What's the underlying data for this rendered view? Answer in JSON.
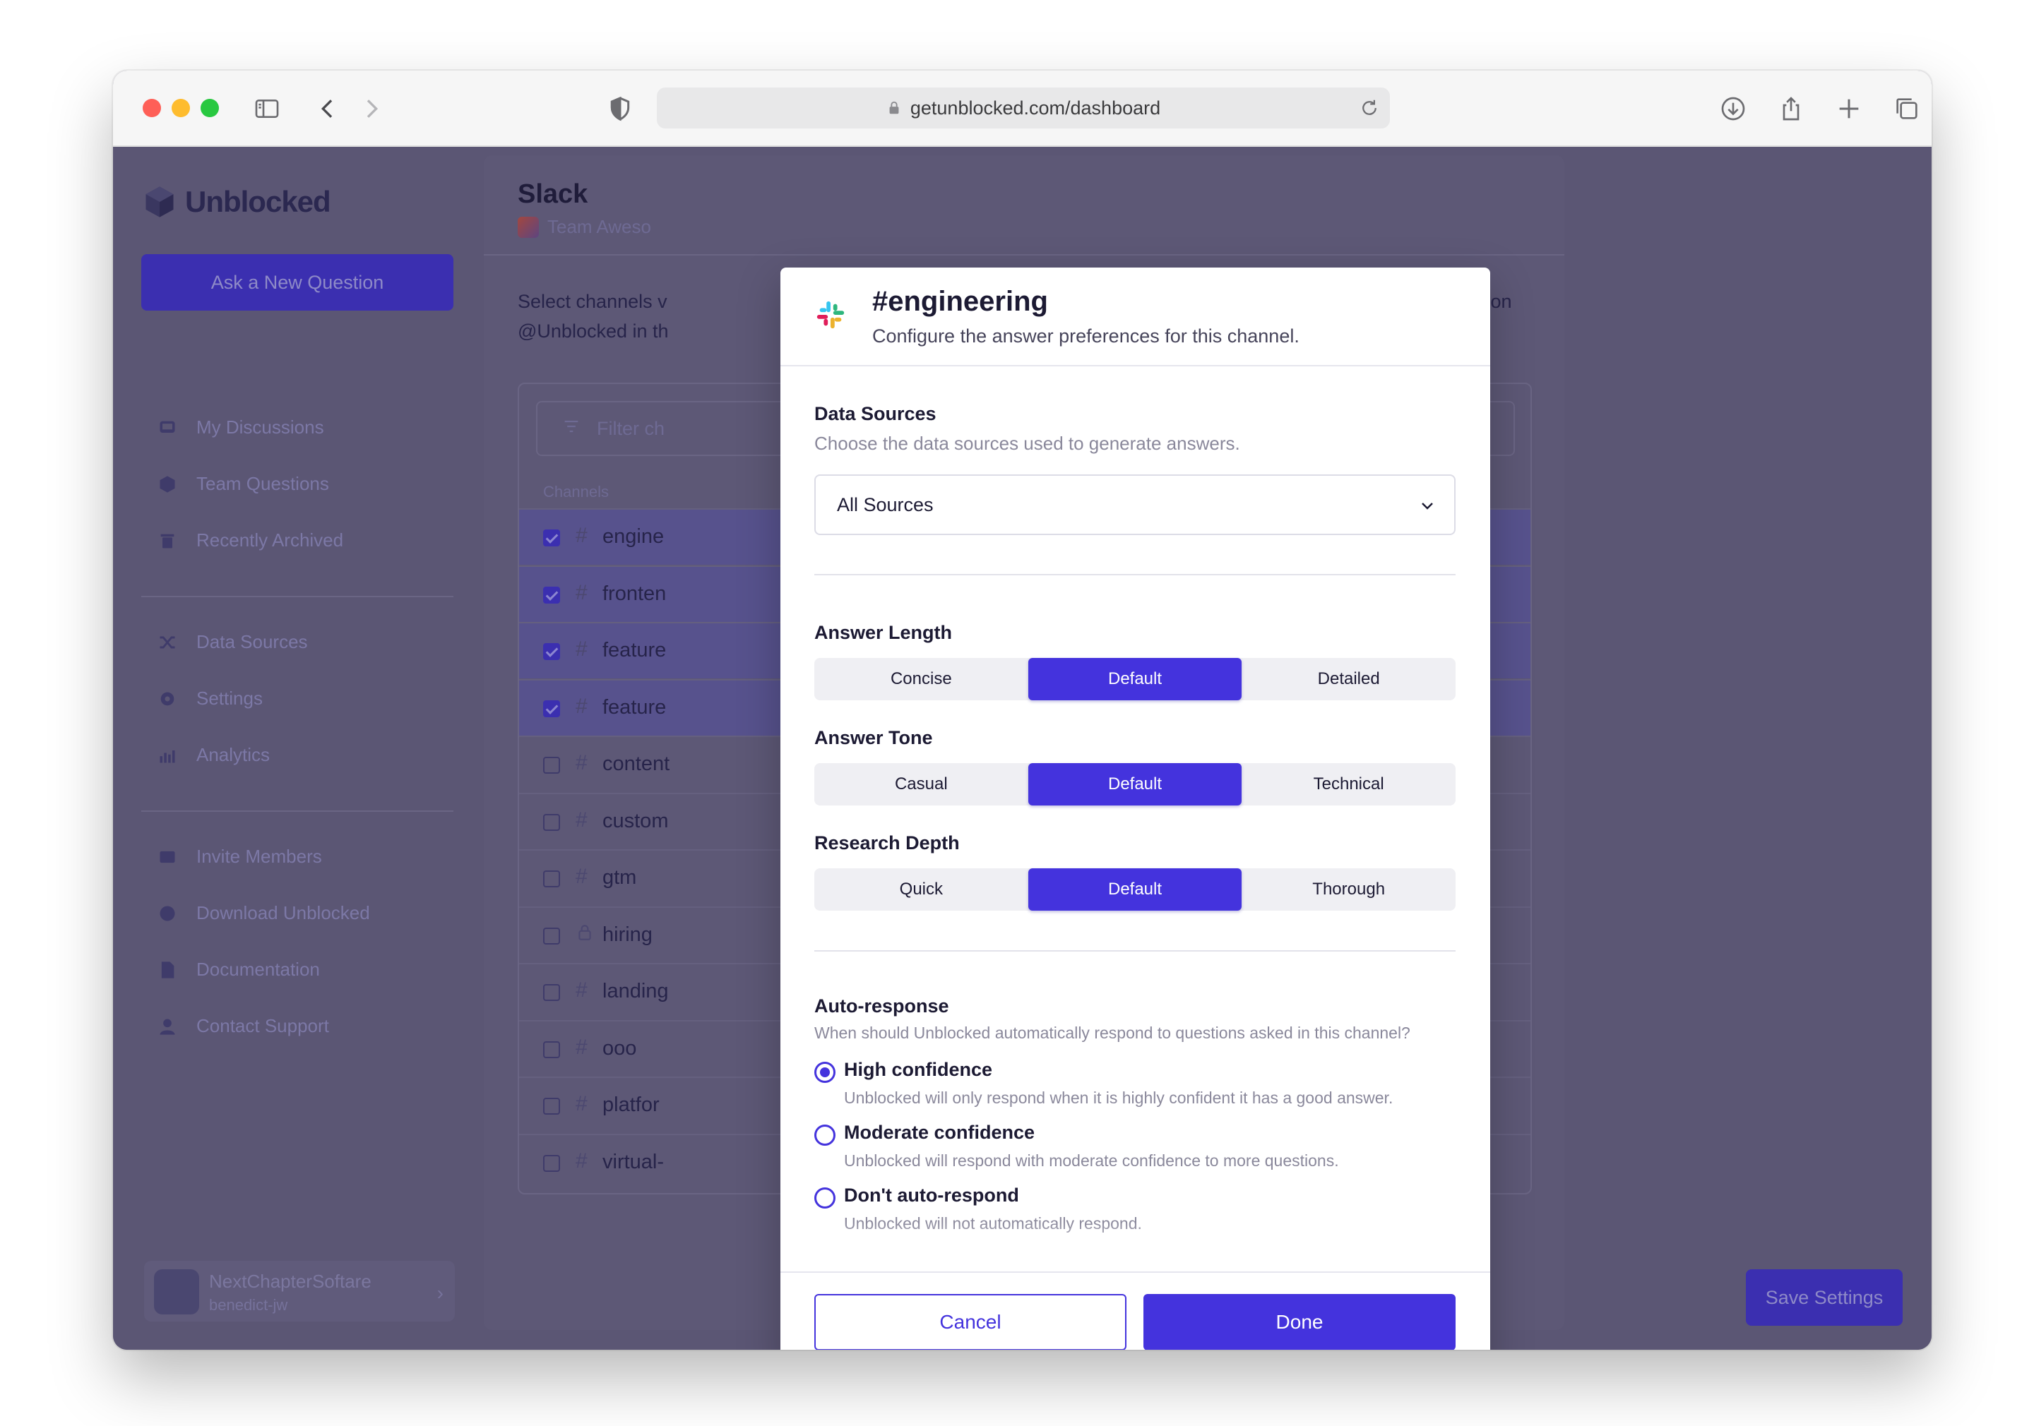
{
  "browser": {
    "url": "getunblocked.com/dashboard"
  },
  "sidebar": {
    "brand": "Unblocked",
    "ask_button": "Ask a New Question",
    "items": [
      {
        "label": "My Discussions",
        "icon": "chat-icon"
      },
      {
        "label": "Team Questions",
        "icon": "cube-icon"
      },
      {
        "label": "Recently Archived",
        "icon": "trash-icon"
      },
      {
        "label": "Data Sources",
        "icon": "shuffle-icon"
      },
      {
        "label": "Settings",
        "icon": "gear-icon"
      },
      {
        "label": "Analytics",
        "icon": "analytics-icon"
      },
      {
        "label": "Invite Members",
        "icon": "mail-icon"
      },
      {
        "label": "Download Unblocked",
        "icon": "download-icon"
      },
      {
        "label": "Documentation",
        "icon": "doc-icon"
      },
      {
        "label": "Contact Support",
        "icon": "person-icon"
      }
    ],
    "workspace": {
      "name": "NextChapterSoftare",
      "user": "benedict-jw"
    }
  },
  "main": {
    "title": "Slack",
    "team": "Team Aweso",
    "description_left_1": "Select channels v",
    "description_left_2": "@Unblocked in th",
    "description_right": "also @-mention",
    "filter_placeholder": "Filter ch",
    "column_header": "Channels",
    "channels": [
      {
        "name": "engine",
        "checked": true,
        "icon": "#"
      },
      {
        "name": "fronten",
        "checked": true,
        "icon": "#"
      },
      {
        "name": "feature",
        "checked": true,
        "icon": "#"
      },
      {
        "name": "feature",
        "checked": true,
        "icon": "#"
      },
      {
        "name": "content",
        "checked": false,
        "icon": "#"
      },
      {
        "name": "custom",
        "checked": false,
        "icon": "#"
      },
      {
        "name": "gtm",
        "checked": false,
        "icon": "#"
      },
      {
        "name": "hiring",
        "checked": false,
        "icon": "lock"
      },
      {
        "name": "landing",
        "checked": false,
        "icon": "#"
      },
      {
        "name": "ooo",
        "checked": false,
        "icon": "#"
      },
      {
        "name": "platfor",
        "checked": false,
        "icon": "#"
      },
      {
        "name": "virtual-",
        "checked": false,
        "icon": "#"
      }
    ],
    "save_button": "Save Settings"
  },
  "modal": {
    "title": "#engineering",
    "subtitle": "Configure the answer preferences for this channel.",
    "data_sources": {
      "title": "Data Sources",
      "description": "Choose the data sources used to generate answers.",
      "selected": "All Sources"
    },
    "answer_length": {
      "title": "Answer Length",
      "options": [
        "Concise",
        "Default",
        "Detailed"
      ],
      "selected": "Default"
    },
    "answer_tone": {
      "title": "Answer Tone",
      "options": [
        "Casual",
        "Default",
        "Technical"
      ],
      "selected": "Default"
    },
    "research_depth": {
      "title": "Research Depth",
      "options": [
        "Quick",
        "Default",
        "Thorough"
      ],
      "selected": "Default"
    },
    "auto_response": {
      "title": "Auto-response",
      "description": "When should Unblocked automatically respond to questions asked in this channel?",
      "options": [
        {
          "label": "High confidence",
          "description": "Unblocked will only respond when it is highly confident it has a good answer.",
          "selected": true
        },
        {
          "label": "Moderate confidence",
          "description": "Unblocked will respond with moderate confidence to more questions.",
          "selected": false
        },
        {
          "label": "Don't auto-respond",
          "description": "Unblocked will not automatically respond.",
          "selected": false
        }
      ]
    },
    "cancel_button": "Cancel",
    "done_button": "Done"
  },
  "colors": {
    "accent": "#4433dd",
    "overlay": "#5b5674"
  }
}
